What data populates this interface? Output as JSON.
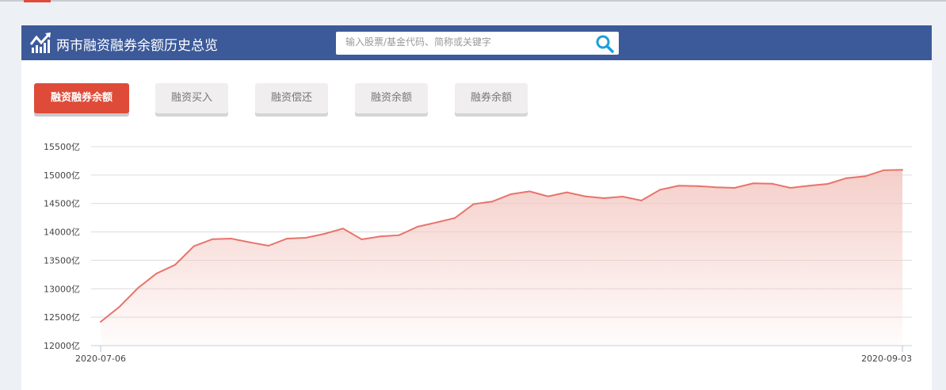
{
  "header": {
    "title": "两市融资融券余额历史总览",
    "search_placeholder": "输入股票/基金代码、简称或关键字"
  },
  "tabs": [
    {
      "label": "融资融券余额",
      "active": true
    },
    {
      "label": "融资买入",
      "active": false
    },
    {
      "label": "融资偿还",
      "active": false
    },
    {
      "label": "融资余额",
      "active": false
    },
    {
      "label": "融券余额",
      "active": false
    }
  ],
  "colors": {
    "header": "#3c5a99",
    "accent": "#de4b39",
    "line": "#e8736a",
    "search_icon": "#1a9fdc"
  },
  "chart_data": {
    "type": "area",
    "title": "",
    "xlabel": "",
    "ylabel": "",
    "unit": "亿",
    "x_start": "2020-07-06",
    "x_end": "2020-09-03",
    "x_tick_labels": [
      "2020-07-06",
      "2020-09-03"
    ],
    "y_ticks": [
      "12000亿",
      "12500亿",
      "13000亿",
      "13500亿",
      "14000亿",
      "14500亿",
      "15000亿",
      "15500亿"
    ],
    "ylim": [
      12000,
      15500
    ],
    "grid": true,
    "values": [
      12418,
      12679,
      13013,
      13269,
      13422,
      13748,
      13873,
      13882,
      13817,
      13757,
      13882,
      13896,
      13966,
      14059,
      13868,
      13920,
      13943,
      14092,
      14166,
      14245,
      14491,
      14533,
      14663,
      14714,
      14626,
      14696,
      14626,
      14594,
      14622,
      14552,
      14742,
      14812,
      14807,
      14784,
      14775,
      14854,
      14849,
      14775,
      14812,
      14845,
      14947,
      14979,
      15086,
      15091
    ]
  }
}
